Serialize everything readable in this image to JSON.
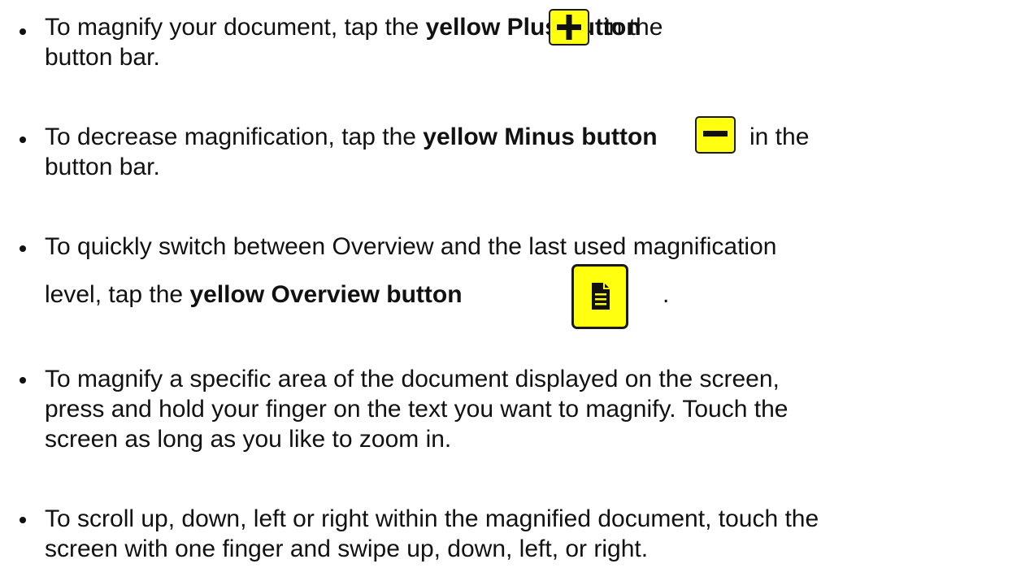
{
  "items": [
    {
      "pre": "To magnify your document, tap the ",
      "bold": "yellow Plus button",
      "post": "in the",
      "line2": "button bar.",
      "icon": "plus-icon"
    },
    {
      "pre": "To decrease magnification, tap the ",
      "bold": "yellow Minus button",
      "post": "in the",
      "line2": "button bar.",
      "icon": "minus-icon"
    },
    {
      "line1": "To quickly switch between Overview and the last used magnification",
      "pre": "level, tap the ",
      "bold": "yellow Overview button",
      "post": ".",
      "icon": "document-icon"
    },
    {
      "lines": [
        "To magnify a specific area of the document displayed on the screen,",
        "press and hold your finger on the text you want to magnify. Touch the",
        "screen as long as you like to zoom in."
      ]
    },
    {
      "lines": [
        "To scroll up, down, left or right within the magnified document, touch the",
        "screen with one finger and swipe up, down, left, or right."
      ]
    }
  ],
  "colors": {
    "button_fill": "#ffff10",
    "button_border": "#1a1a1a",
    "text": "#111111"
  }
}
